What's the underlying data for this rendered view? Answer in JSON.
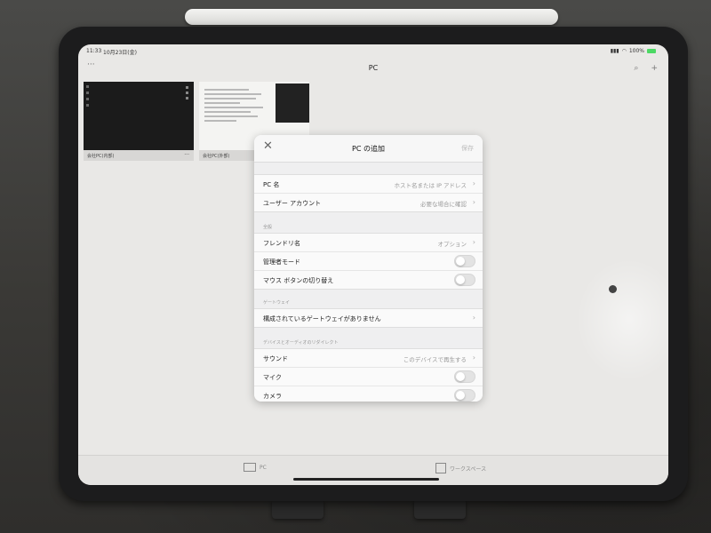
{
  "status": {
    "time": "11:33",
    "date": "10月23日(金)",
    "battery": "100%"
  },
  "nav": {
    "title": "PC",
    "more": "···"
  },
  "thumbnails": [
    {
      "label": "会社PC(内部)",
      "menu": "···"
    },
    {
      "label": "会社PC(外部)",
      "menu": "···"
    }
  ],
  "tabbar": {
    "pc": "PC",
    "workspaces": "ワークスペース"
  },
  "modal": {
    "close": "✕",
    "title": "PC の追加",
    "save": "保存",
    "pc_name": {
      "label": "PC 名",
      "value": "ホスト名または IP アドレス"
    },
    "user_account": {
      "label": "ユーザー アカウント",
      "value": "必要な場合に確認"
    },
    "general_header": "全般",
    "friendly_name": {
      "label": "フレンドリ名",
      "value": "オプション"
    },
    "admin_mode": {
      "label": "管理者モード"
    },
    "mouse_swap": {
      "label": "マウス ボタンの切り替え"
    },
    "gateway_header": "ゲートウェイ",
    "gateway": {
      "label": "構成されているゲートウェイがありません"
    },
    "redirect_header": "デバイスとオーディオのリダイレクト",
    "sound": {
      "label": "サウンド",
      "value": "このデバイスで再生する"
    },
    "mic": {
      "label": "マイク"
    },
    "camera": {
      "label": "カメラ"
    }
  },
  "icons": [
    "chevron-right-icon",
    "close-icon",
    "monitor-icon",
    "grid-icon",
    "search-icon",
    "add-icon",
    "wifi-icon",
    "battery-icon"
  ]
}
